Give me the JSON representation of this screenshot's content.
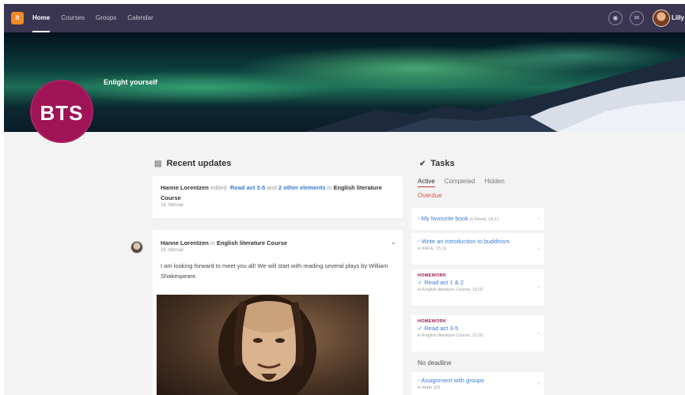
{
  "nav": {
    "logo": "it",
    "items": [
      "Home",
      "Courses",
      "Groups",
      "Calendar"
    ],
    "user": "Lilly"
  },
  "banner": {
    "initials": "BTS",
    "title": "Enlight yourself"
  },
  "recent_updates": {
    "heading": "Recent updates",
    "item": {
      "author": "Hanne Lorentzen",
      "verb": "edited",
      "link1": "Read act 3-5",
      "and": "and",
      "link2": "2 other elements",
      "in": "in",
      "course": "English literature Course",
      "date": "16. februar"
    }
  },
  "post": {
    "author": "Hanne Lorentzen",
    "in": "in",
    "course": "English literature Course",
    "date": "16. februar",
    "body": "I am looking forward to meet you all! We will start with reading several plays by William Shakespeare."
  },
  "tasks": {
    "heading": "Tasks",
    "tabs": [
      "Active",
      "Completed",
      "Hidden"
    ],
    "overdue_label": "Overdue",
    "no_deadline_label": "No deadline",
    "items": [
      {
        "kind": "",
        "title": "My favourite book",
        "sub": "in Norsk, 14.11"
      },
      {
        "kind": "",
        "title": "Write an introduction to buddhism",
        "sub": "in KRLE, 15.11"
      },
      {
        "kind": "HOMEWORK",
        "title": "Read act 1 & 2",
        "sub": "in English literature Course, 15.02"
      },
      {
        "kind": "HOMEWORK",
        "title": "Read act 3-5",
        "sub": "in English literature Course, 22.02"
      },
      {
        "kind": "",
        "title": "Assignment with groups",
        "sub": "in Math 101"
      }
    ]
  },
  "colors": {
    "topbar": "#3a3550",
    "brand": "#9e1456",
    "link": "#3a7bd5",
    "overdue": "#d9534f"
  }
}
